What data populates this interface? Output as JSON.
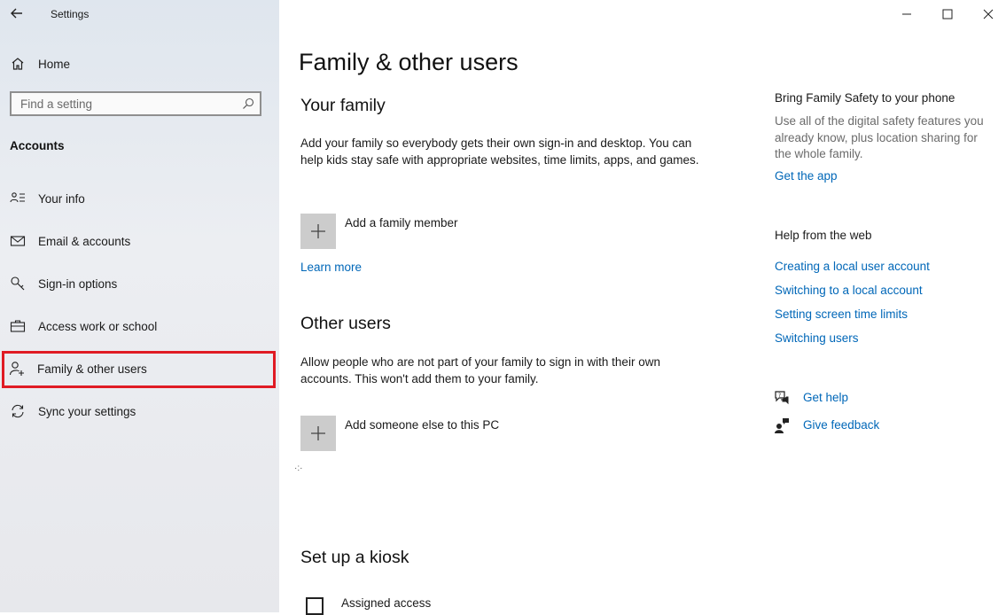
{
  "window": {
    "app_title": "Settings",
    "controls": [
      "minimize",
      "maximize",
      "close"
    ]
  },
  "sidebar": {
    "home_label": "Home",
    "search_placeholder": "Find a setting",
    "section_header": "Accounts",
    "items": [
      {
        "label": "Your info",
        "icon": "person-list-icon"
      },
      {
        "label": "Email & accounts",
        "icon": "mail-icon"
      },
      {
        "label": "Sign-in options",
        "icon": "key-icon"
      },
      {
        "label": "Access work or school",
        "icon": "briefcase-icon"
      },
      {
        "label": "Family & other users",
        "icon": "person-add-icon",
        "selected": true
      },
      {
        "label": "Sync your settings",
        "icon": "sync-icon"
      }
    ],
    "highlight_color": "#e01b24"
  },
  "main": {
    "title": "Family & other users",
    "your_family": {
      "heading": "Your family",
      "description": "Add your family so everybody gets their own sign-in and desktop. You can help kids stay safe with appropriate websites, time limits, apps, and games.",
      "add_label": "Add a family member",
      "learn_more": "Learn more"
    },
    "other_users": {
      "heading": "Other users",
      "description": "Allow people who are not part of your family to sign in with their own accounts. This won't add them to your family.",
      "add_label": "Add someone else to this PC"
    },
    "kiosk": {
      "heading": "Set up a kiosk",
      "assigned_access": "Assigned access"
    }
  },
  "right_column": {
    "family_safety": {
      "heading": "Bring Family Safety to your phone",
      "description": "Use all of the digital safety features you already know, plus location sharing for the whole family.",
      "link": "Get the app"
    },
    "help_from_web": {
      "heading": "Help from the web",
      "links": [
        "Creating a local user account",
        "Switching to a local account",
        "Setting screen time limits",
        "Switching users"
      ]
    },
    "get_help": "Get help",
    "give_feedback": "Give feedback",
    "link_color": "#0067b8"
  }
}
